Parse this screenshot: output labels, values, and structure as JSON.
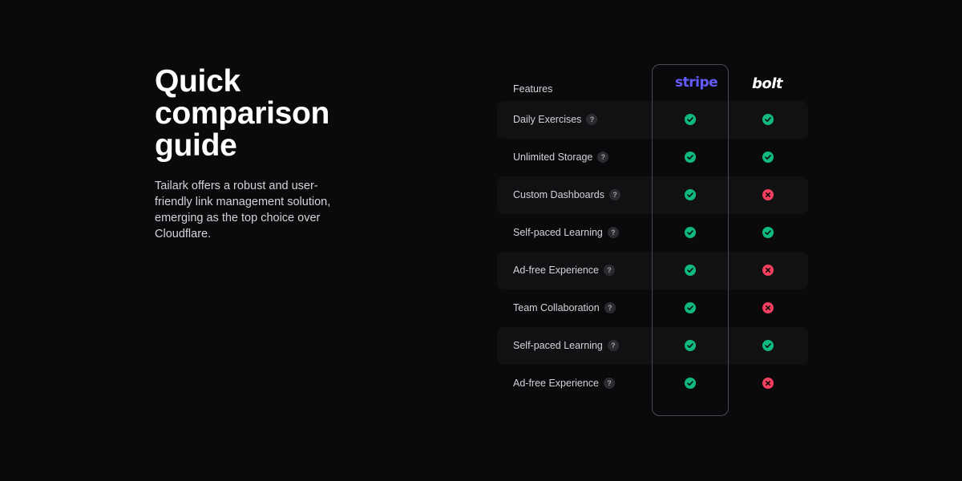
{
  "heading": {
    "line1": "Quick",
    "line2": "comparison",
    "line3": "guide"
  },
  "description": "Tailark offers a robust and user-friendly link management solution, emerging as the top choice over Cloudflare.",
  "table": {
    "features_label": "Features",
    "brands": [
      "stripe",
      "bolt"
    ],
    "rows": [
      {
        "label": "Daily Exercises",
        "stripe": true,
        "bolt": true
      },
      {
        "label": "Unlimited Storage",
        "stripe": true,
        "bolt": true
      },
      {
        "label": "Custom Dashboards",
        "stripe": true,
        "bolt": false
      },
      {
        "label": "Self-paced Learning",
        "stripe": true,
        "bolt": true
      },
      {
        "label": "Ad-free Experience",
        "stripe": true,
        "bolt": false
      },
      {
        "label": "Team Collaboration",
        "stripe": true,
        "bolt": false
      },
      {
        "label": "Self-paced Learning",
        "stripe": true,
        "bolt": true
      },
      {
        "label": "Ad-free Experience",
        "stripe": true,
        "bolt": false
      }
    ],
    "help_glyph": "?",
    "icons": {
      "yes": "check-circle-icon",
      "no": "x-circle-icon"
    }
  },
  "colors": {
    "background": "#0a0a0c",
    "yes": "#10b981",
    "no": "#f43f5e",
    "stripe_brand": "#635bff"
  }
}
